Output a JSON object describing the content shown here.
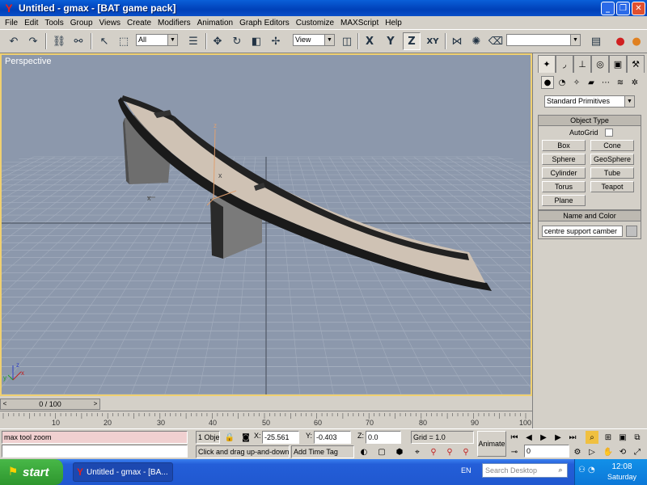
{
  "window": {
    "title": "Untitled - gmax - [BAT game pack]"
  },
  "menu": [
    "File",
    "Edit",
    "Tools",
    "Group",
    "Views",
    "Create",
    "Modifiers",
    "Animation",
    "Graph Editors",
    "Customize",
    "MAXScript",
    "Help"
  ],
  "toolbar": {
    "selection_filter": "All",
    "ref_coord": "View",
    "axis_x": "X",
    "axis_y": "Y",
    "axis_z": "Z",
    "axis_xy": "XY",
    "named_selection": ""
  },
  "viewport": {
    "label": "Perspective",
    "axis_z": "z",
    "axis_x": "x",
    "axis_y": "y"
  },
  "command_panel": {
    "category": "Standard Primitives",
    "object_type_title": "Object Type",
    "autogrid_label": "AutoGrid",
    "buttons": [
      "Box",
      "Cone",
      "Sphere",
      "GeoSphere",
      "Cylinder",
      "Tube",
      "Torus",
      "Teapot",
      "Plane"
    ],
    "name_color_title": "Name and Color",
    "object_name": "centre support camber"
  },
  "time_slider": {
    "frame_display": "0 / 100",
    "left_arrow": "<",
    "right_arrow": ">"
  },
  "trackbar": {
    "ticks": [
      "10",
      "20",
      "30",
      "40",
      "50",
      "60",
      "70",
      "80",
      "90",
      "100"
    ]
  },
  "status": {
    "script_listener": "max tool zoom",
    "selection": "1 Obje",
    "x_label": "X:",
    "x_value": "-25.561",
    "y_label": "Y:",
    "y_value": "-0.403",
    "z_label": "Z:",
    "z_value": "0.0",
    "grid": "Grid = 1.0",
    "prompt": "Click and drag up-and-down to",
    "time_tag": "Add Time Tag",
    "animate": "Animate",
    "current_frame": "0"
  },
  "taskbar": {
    "start": "start",
    "task_item": "Untitled - gmax - [BA...",
    "language": "EN",
    "search_placeholder": "Search Desktop",
    "time": "12:08",
    "day": "Saturday"
  }
}
